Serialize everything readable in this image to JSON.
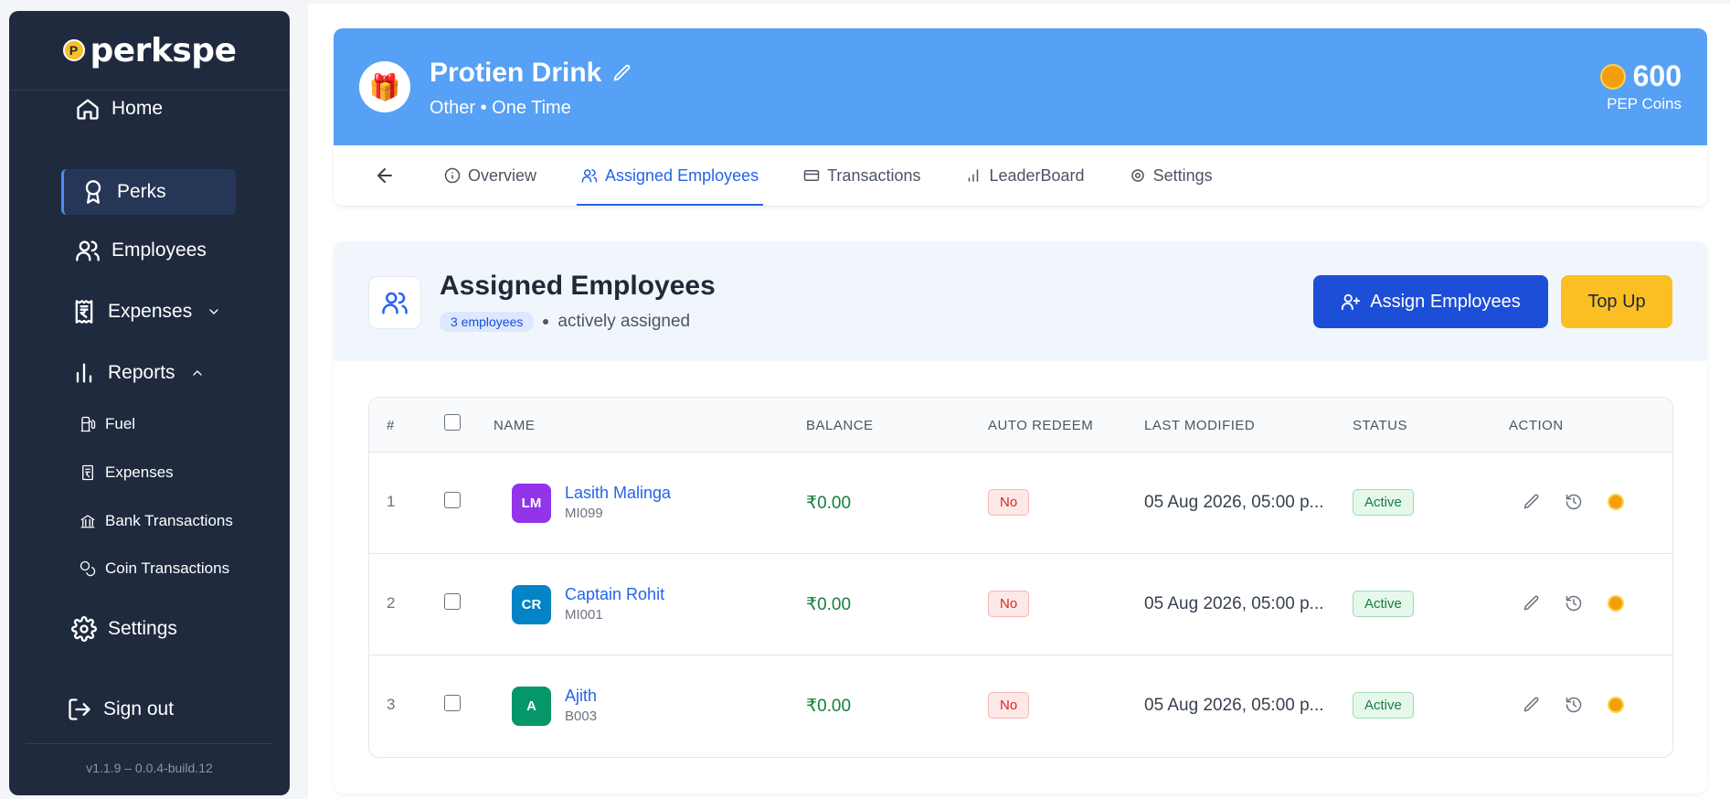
{
  "sidebar": {
    "logo": "perkspe",
    "logo_mark": "P",
    "items": {
      "home": "Home",
      "perks": "Perks",
      "employees": "Employees",
      "expenses": "Expenses",
      "reports": "Reports",
      "settings": "Settings",
      "signout": "Sign out"
    },
    "reports_sub": {
      "fuel": "Fuel",
      "expenses": "Expenses",
      "bank": "Bank Transactions",
      "coin": "Coin Transactions"
    },
    "version": "v1.1.9 – 0.0.4-build.12"
  },
  "perk": {
    "title": "Protien Drink",
    "subtitle": "Other • One Time",
    "coins_value": "600",
    "coins_label": "PEP Coins"
  },
  "tabs": {
    "overview": "Overview",
    "assigned": "Assigned Employees",
    "transactions": "Transactions",
    "leaderboard": "LeaderBoard",
    "settings": "Settings"
  },
  "section": {
    "title": "Assigned Employees",
    "count_pill": "3 employees",
    "subtitle": "actively assigned",
    "assign_button": "Assign Employees",
    "topup_button": "Top Up"
  },
  "table": {
    "headers": {
      "num": "#",
      "name": "NAME",
      "balance": "BALANCE",
      "auto_redeem": "AUTO REDEEM",
      "last_modified": "LAST MODIFIED",
      "status": "STATUS",
      "action": "ACTION"
    },
    "rows": [
      {
        "num": "1",
        "initials": "LM",
        "name": "Lasith Malinga",
        "id": "MI099",
        "balance": "₹0.00",
        "auto_redeem": "No",
        "last_modified": "05 Aug 2026, 05:00 p...",
        "status": "Active",
        "avatar_color": "#9333ea"
      },
      {
        "num": "2",
        "initials": "CR",
        "name": "Captain Rohit",
        "id": "MI001",
        "balance": "₹0.00",
        "auto_redeem": "No",
        "last_modified": "05 Aug 2026, 05:00 p...",
        "status": "Active",
        "avatar_color": "#0284c7"
      },
      {
        "num": "3",
        "initials": "A",
        "name": "Ajith",
        "id": "B003",
        "balance": "₹0.00",
        "auto_redeem": "No",
        "last_modified": "05 Aug 2026, 05:00 p...",
        "status": "Active",
        "avatar_color": "#059669"
      }
    ]
  },
  "colors": {
    "accent": "#2563eb",
    "banner": "#56a0f5",
    "sidebar": "#1f2a3f",
    "topup": "#fbbf24"
  }
}
